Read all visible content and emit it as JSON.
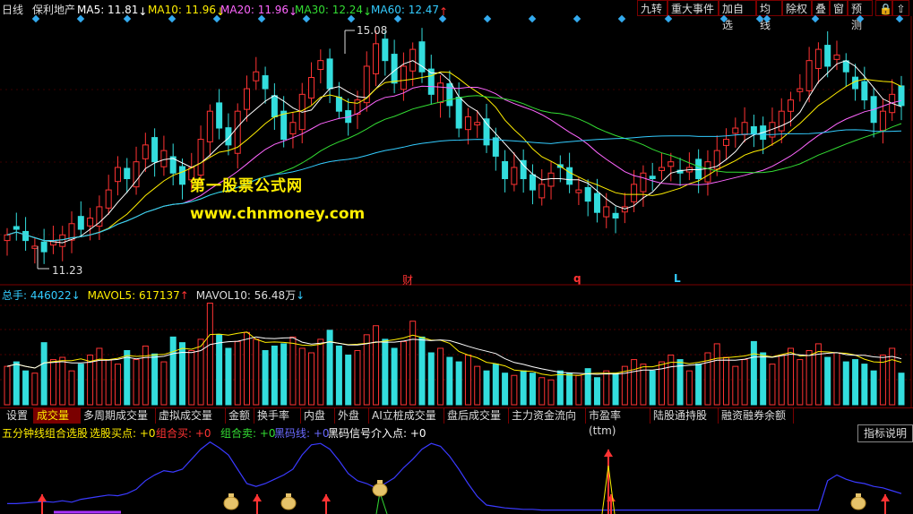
{
  "header": {
    "period": "日线",
    "stock_name": "保利地产",
    "ma5": {
      "label": "MA5: 11.81",
      "arrow": "↓",
      "color": "#ffffff"
    },
    "ma10": {
      "label": "MA10: 11.96",
      "arrow": "↓",
      "color": "#ffee00"
    },
    "ma20": {
      "label": "MA20: 11.96",
      "arrow": "↓",
      "color": "#ff66ff"
    },
    "ma30": {
      "label": "MA30: 12.24",
      "arrow": "↓",
      "color": "#33dd33"
    },
    "ma60": {
      "label": "MA60: 12.47",
      "arrow": "↑",
      "color": "#33ccff"
    }
  },
  "toolbar": [
    "九转",
    "重大事件",
    "加自选",
    "均线",
    "除权",
    "叠",
    "窗",
    "预测"
  ],
  "price_chart": {
    "high_label": "15.08",
    "low_label": "11.23",
    "markers": [
      "财",
      "q",
      "L"
    ]
  },
  "watermark": {
    "line1": "第一股票公式网",
    "line2": "www.chnmoney.com"
  },
  "volume_header": {
    "total": "总手: 446022",
    "total_arrow": "↓",
    "mavol5": "MAVOL5: 617137",
    "mavol5_arrow": "↑",
    "mavol10": "MAVOL10: 56.48万",
    "mavol10_arrow": "↓"
  },
  "tabs": [
    "设置",
    "成交量",
    "多周期成交量",
    "虚拟成交量",
    "金额",
    "换手率",
    "内盘",
    "外盘",
    "AI立桩成交量",
    "盘后成交量",
    "主力资金流向",
    "市盈率(ttm)",
    "陆股通持股",
    "融资融券余额"
  ],
  "active_tab": 1,
  "indicator": {
    "name": "五分钟线组合选股",
    "items": [
      {
        "label": "选股买点: +0",
        "color": "#ffee00"
      },
      {
        "label": "组合买: +0",
        "color": "#ff3333"
      },
      {
        "label": "组合卖: +0",
        "color": "#33dd33"
      },
      {
        "label": "黑码线: +0",
        "color": "#6a6aff"
      },
      {
        "label": "黑码信号介入点: +0",
        "color": "#ffffff"
      }
    ],
    "button": "指标说明"
  },
  "chart_data": {
    "type": "candlestick",
    "closes": [
      11.6,
      11.7,
      11.5,
      11.4,
      11.3,
      11.5,
      11.6,
      11.8,
      11.7,
      11.9,
      12.1,
      12.4,
      12.8,
      12.6,
      12.9,
      13.2,
      12.9,
      13.1,
      12.7,
      12.5,
      12.8,
      13.3,
      13.8,
      13.5,
      13.2,
      13.8,
      14.2,
      14.5,
      14.2,
      13.7,
      13.3,
      13.6,
      14.1,
      14.4,
      14.7,
      14.2,
      13.8,
      13.6,
      14.0,
      14.6,
      15.0,
      14.7,
      14.3,
      14.6,
      14.9,
      14.5,
      14.1,
      14.3,
      13.9,
      13.5,
      13.7,
      13.6,
      13.2,
      13.0,
      12.6,
      12.8,
      12.6,
      12.4,
      12.5,
      12.7,
      12.8,
      12.5,
      12.4,
      12.2,
      12.0,
      12.1,
      11.9,
      12.1,
      12.5,
      12.7,
      12.6,
      12.8,
      12.9,
      12.7,
      12.8,
      12.6,
      12.9,
      13.1,
      13.3,
      13.5,
      13.6,
      13.4,
      13.3,
      13.6,
      13.8,
      14.0,
      14.2,
      14.7,
      14.9,
      14.6,
      14.8,
      14.5,
      14.2,
      14.0,
      13.6,
      13.8,
      14.1,
      13.9
    ]
  },
  "volume_data": [
    34,
    38,
    30,
    28,
    55,
    40,
    42,
    30,
    36,
    44,
    50,
    40,
    36,
    48,
    40,
    52,
    45,
    38,
    60,
    55,
    48,
    58,
    90,
    62,
    50,
    56,
    64,
    58,
    48,
    52,
    54,
    60,
    50,
    46,
    58,
    66,
    52,
    44,
    48,
    62,
    70,
    58,
    50,
    56,
    74,
    60,
    46,
    50,
    42,
    38,
    44,
    34,
    30,
    36,
    28,
    26,
    30,
    28,
    24,
    22,
    30,
    28,
    26,
    32,
    24,
    30,
    28,
    34,
    40,
    36,
    30,
    38,
    44,
    40,
    30,
    36,
    46,
    54,
    42,
    34,
    40,
    56,
    46,
    36,
    44,
    50,
    40,
    48,
    54,
    42,
    46,
    38,
    40,
    36,
    30,
    44,
    50,
    28
  ],
  "indicator_data": [
    12,
    12,
    13,
    14,
    15,
    14,
    16,
    14,
    18,
    20,
    22,
    24,
    23,
    26,
    32,
    44,
    52,
    58,
    56,
    60,
    74,
    88,
    98,
    90,
    80,
    60,
    40,
    36,
    40,
    46,
    52,
    60,
    80,
    94,
    96,
    88,
    72,
    54,
    44,
    40,
    34,
    40,
    48,
    62,
    74,
    88,
    96,
    92,
    78,
    60,
    40,
    22,
    10,
    8,
    6,
    5,
    4,
    4,
    3,
    3,
    3,
    3,
    3,
    3,
    3,
    3,
    3,
    3,
    3,
    3,
    3,
    3,
    3,
    3,
    3,
    3,
    3,
    3,
    3,
    3,
    3,
    3,
    3,
    3,
    3,
    3,
    3,
    3,
    3,
    44,
    52,
    46,
    42,
    40,
    36,
    34,
    30,
    26
  ]
}
